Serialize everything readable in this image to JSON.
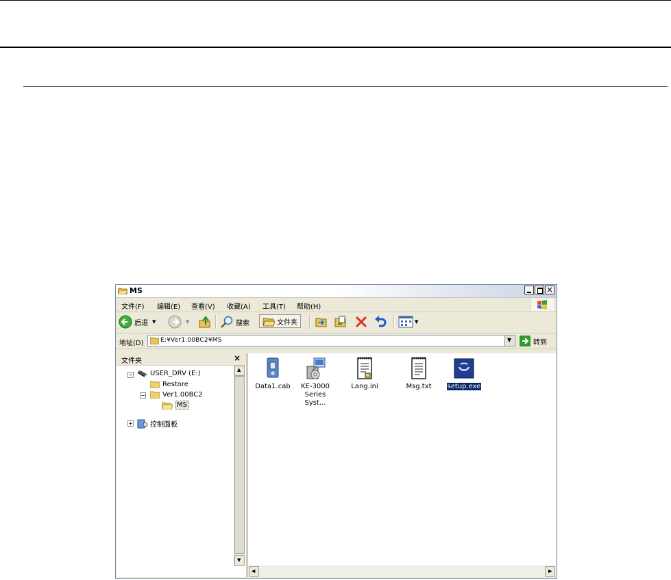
{
  "window": {
    "title": "MS",
    "menu": [
      "文件(F)",
      "编辑(E)",
      "查看(V)",
      "收藏(A)",
      "工具(T)",
      "帮助(H)"
    ],
    "toolbar": {
      "back_label": "后退",
      "search_label": "搜索",
      "folders_label": "文件夹"
    },
    "address": {
      "label": "地址(D)",
      "value": "E:¥Ver1.00BC2¥MS",
      "go_label": "转到"
    },
    "left_pane": {
      "header": "文件夹",
      "tree": [
        "USER_DRV (E:)",
        "Restore",
        "Ver1.00BC2",
        "MS",
        "控制面板"
      ]
    },
    "files": [
      {
        "name": "Data1.cab",
        "icon": "cab-archive-icon"
      },
      {
        "name": "KE-3000 Series Syst...",
        "icon": "installer-package-icon"
      },
      {
        "name": "Lang.ini",
        "icon": "ini-file-icon"
      },
      {
        "name": "Msg.txt",
        "icon": "text-file-icon"
      },
      {
        "name": "setup.exe",
        "icon": "setup-exe-icon",
        "selected": true
      }
    ],
    "colors": {
      "selection": "#0a246a",
      "chrome": "#ece9d8"
    }
  }
}
